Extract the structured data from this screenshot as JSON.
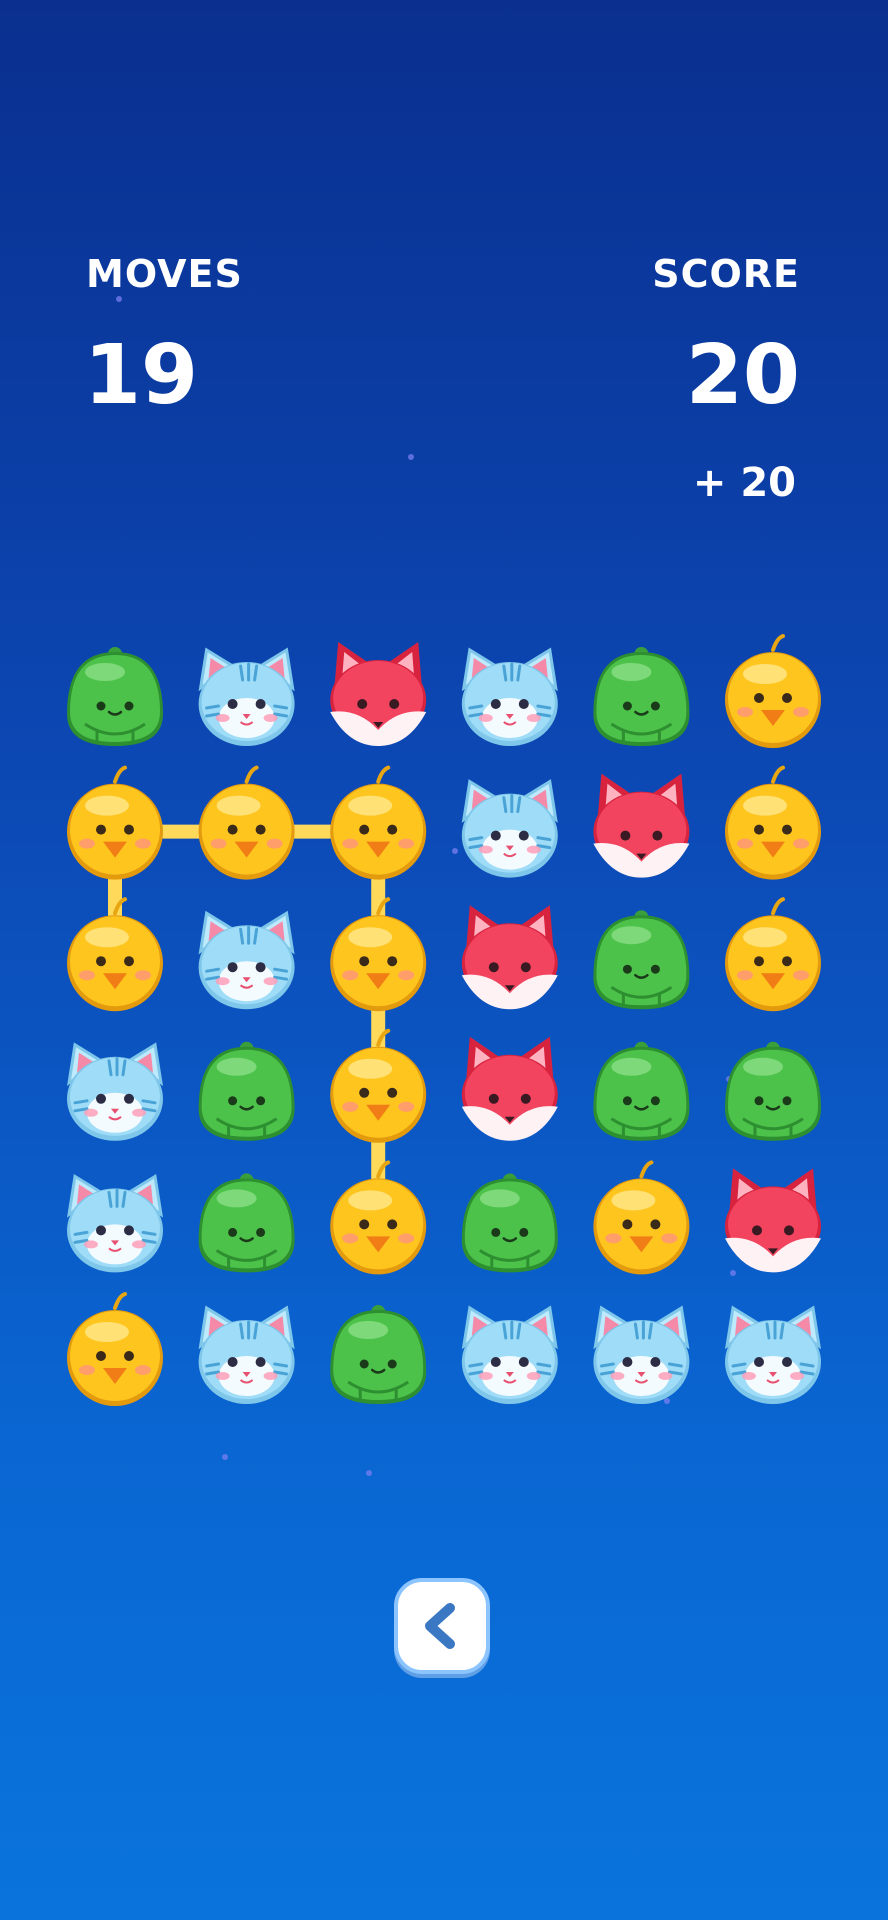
{
  "hud": {
    "moves_label": "MOVES",
    "moves_value": "19",
    "score_label": "SCORE",
    "score_value": "20",
    "score_bonus": "+ 20"
  },
  "colors": {
    "chick": "#ffc51f",
    "cat": "#9fdcf7",
    "fox": "#f2445f",
    "frog": "#4cc24a",
    "path": "#ffd95a"
  },
  "board": {
    "rows": 6,
    "cols": 6,
    "grid": [
      [
        "frog",
        "cat",
        "fox",
        "cat",
        "frog",
        "chick"
      ],
      [
        "chick",
        "chick",
        "chick",
        "cat",
        "fox",
        "chick"
      ],
      [
        "chick",
        "cat",
        "chick",
        "fox",
        "frog",
        "chick"
      ],
      [
        "cat",
        "frog",
        "chick",
        "fox",
        "frog",
        "frog"
      ],
      [
        "cat",
        "frog",
        "chick",
        "frog",
        "chick",
        "fox"
      ],
      [
        "chick",
        "cat",
        "frog",
        "cat",
        "cat",
        "cat"
      ]
    ],
    "selected_path": [
      [
        2,
        0
      ],
      [
        1,
        0
      ],
      [
        1,
        1
      ],
      [
        1,
        2
      ],
      [
        2,
        2
      ],
      [
        3,
        2
      ],
      [
        4,
        2
      ]
    ]
  },
  "controls": {
    "back_icon": "chevron-left-icon"
  }
}
